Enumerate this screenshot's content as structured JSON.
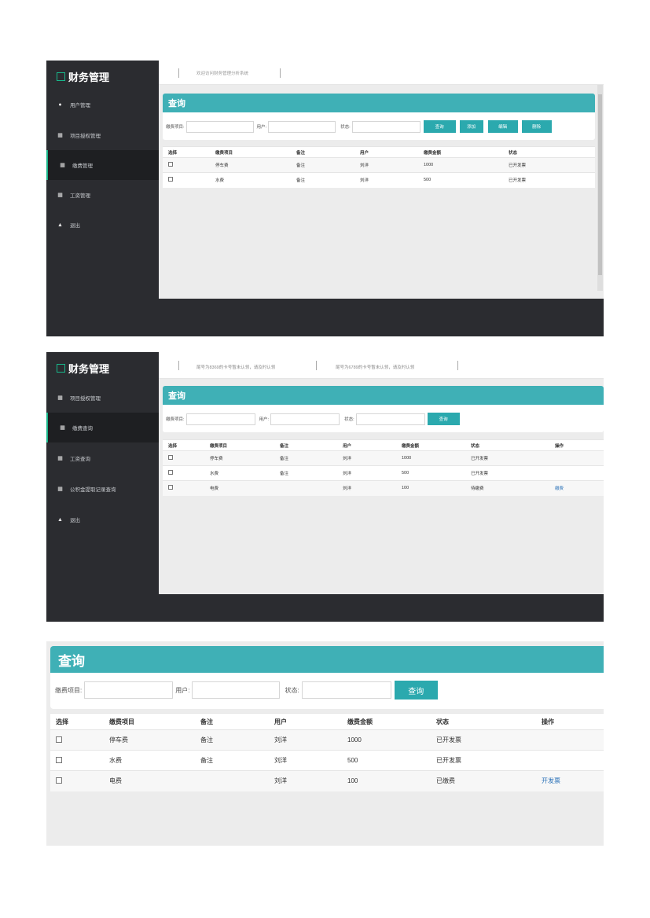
{
  "shot1": {
    "brand": "财务管理",
    "nav": [
      {
        "icon": "users-icon",
        "label": "用户管理"
      },
      {
        "icon": "database-icon",
        "label": "项目授权管理"
      },
      {
        "icon": "database-icon",
        "label": "缴费管理"
      },
      {
        "icon": "database-icon",
        "label": "工资管理"
      },
      {
        "icon": "eject-icon",
        "label": "退出"
      }
    ],
    "topbar_text": "欢迎访问财务管理分析系统",
    "panel_title": "查询",
    "form": {
      "item_label": "缴费项目:",
      "user_label": "用户:",
      "status_label": "状态:"
    },
    "buttons": {
      "query": "查询",
      "add": "添加",
      "edit": "编辑",
      "delete": "删除"
    },
    "table": {
      "headers": [
        "选择",
        "缴费项目",
        "备注",
        "用户",
        "缴费金额",
        "状态"
      ],
      "rows": [
        {
          "item": "停车费",
          "note": "备注",
          "user": "刘洋",
          "amount": "1000",
          "status": "已开发票"
        },
        {
          "item": "水费",
          "note": "备注",
          "user": "刘洋",
          "amount": "500",
          "status": "已开发票"
        }
      ]
    }
  },
  "shot2": {
    "brand": "财务管理",
    "nav": [
      {
        "icon": "database-icon",
        "label": "项目授权管理"
      },
      {
        "icon": "database-icon",
        "label": "缴费查询"
      },
      {
        "icon": "database-icon",
        "label": "工资查询"
      },
      {
        "icon": "database-icon",
        "label": "公积金提取记录查询"
      },
      {
        "icon": "eject-icon",
        "label": "退出"
      }
    ],
    "notices": [
      "尾号为8369的卡号暂未认领，请及时认领",
      "尾号为6789的卡号暂未认领，请及时认领"
    ],
    "panel_title": "查询",
    "form": {
      "item_label": "缴费项目:",
      "user_label": "用户:",
      "status_label": "状态:"
    },
    "buttons": {
      "query": "查询"
    },
    "table": {
      "headers": [
        "选择",
        "缴费项目",
        "备注",
        "用户",
        "缴费金额",
        "状态",
        "操作"
      ],
      "rows": [
        {
          "item": "停车费",
          "note": "备注",
          "user": "刘洋",
          "amount": "1000",
          "status": "已开发票",
          "action": ""
        },
        {
          "item": "水费",
          "note": "备注",
          "user": "刘洋",
          "amount": "500",
          "status": "已开发票",
          "action": ""
        },
        {
          "item": "电费",
          "note": "",
          "user": "刘洋",
          "amount": "100",
          "status": "待缴费",
          "action": "缴费"
        }
      ]
    }
  },
  "shot3": {
    "panel_title": "查询",
    "form": {
      "item_label": "缴费项目:",
      "user_label": "用户:",
      "status_label": "状态:"
    },
    "buttons": {
      "query": "查询"
    },
    "table": {
      "headers": [
        "选择",
        "缴费项目",
        "备注",
        "用户",
        "缴费金额",
        "状态",
        "操作"
      ],
      "rows": [
        {
          "item": "停车费",
          "note": "备注",
          "user": "刘洋",
          "amount": "1000",
          "status": "已开发票",
          "action": ""
        },
        {
          "item": "水费",
          "note": "备注",
          "user": "刘洋",
          "amount": "500",
          "status": "已开发票",
          "action": ""
        },
        {
          "item": "电费",
          "note": "",
          "user": "刘洋",
          "amount": "100",
          "status": "已缴费",
          "action": "开发票"
        }
      ]
    }
  }
}
